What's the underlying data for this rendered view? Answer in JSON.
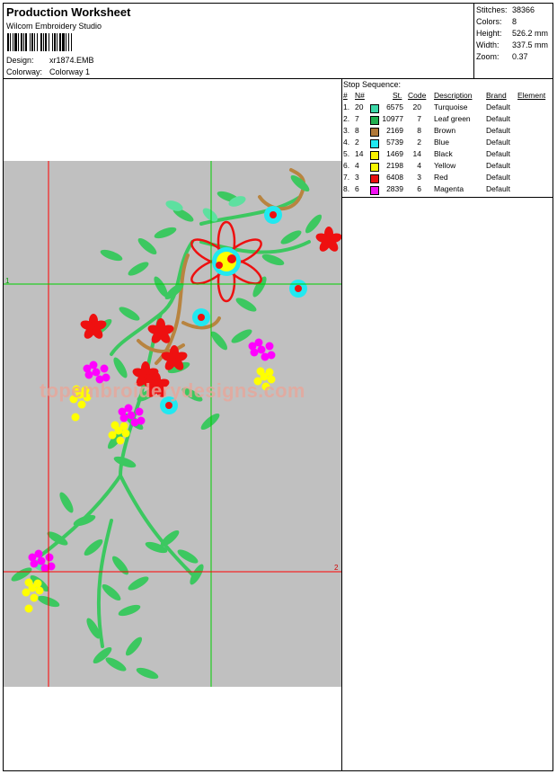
{
  "header": {
    "title": "Production Worksheet",
    "software": "Wilcom  Embroidery Studio",
    "design_label": "Design:",
    "design_value": "xr1874.EMB",
    "colorway_label": "Colorway:",
    "colorway_value": "Colorway 1"
  },
  "stats": [
    {
      "label": "Stitches:",
      "value": "38366"
    },
    {
      "label": "Colors:",
      "value": "8"
    },
    {
      "label": "Height:",
      "value": "526.2 mm"
    },
    {
      "label": "Width:",
      "value": "337.5 mm"
    },
    {
      "label": "Zoom:",
      "value": "0.37"
    }
  ],
  "stop_sequence": {
    "title": "Stop Sequence:",
    "columns": [
      "#",
      "N#",
      "St.",
      "Code",
      "Description",
      "Brand",
      "Element"
    ],
    "rows": [
      {
        "num": "1.",
        "n": "20",
        "color": "#3cd8a8",
        "st": "6575",
        "code": "20",
        "desc": "Turquoise",
        "brand": "Default"
      },
      {
        "num": "2.",
        "n": "7",
        "color": "#22b050",
        "st": "10977",
        "code": "7",
        "desc": "Leaf green",
        "brand": "Default"
      },
      {
        "num": "3.",
        "n": "8",
        "color": "#b07838",
        "st": "2169",
        "code": "8",
        "desc": "Brown",
        "brand": "Default"
      },
      {
        "num": "4.",
        "n": "2",
        "color": "#20e8f0",
        "st": "5739",
        "code": "2",
        "desc": "Blue",
        "brand": "Default"
      },
      {
        "num": "5.",
        "n": "14",
        "color": "#f8f000",
        "st": "1469",
        "code": "14",
        "desc": "Black",
        "brand": "Default"
      },
      {
        "num": "6.",
        "n": "4",
        "color": "#f8f800",
        "st": "2198",
        "code": "4",
        "desc": "Yellow",
        "brand": "Default"
      },
      {
        "num": "7.",
        "n": "3",
        "color": "#e81010",
        "st": "6408",
        "code": "3",
        "desc": "Red",
        "brand": "Default"
      },
      {
        "num": "8.",
        "n": "6",
        "color": "#f010f0",
        "st": "2839",
        "code": "6",
        "desc": "Magenta",
        "brand": "Default"
      }
    ]
  },
  "canvas": {
    "watermark": "topembroiderydesigns.com",
    "marker_1": "1",
    "marker_2": "2",
    "colors": {
      "background": "#c0c0c0",
      "leaf": "#3cc860",
      "leaf_light": "#5ee0a0",
      "brown": "#b88440",
      "red": "#ee1010",
      "cyan": "#22e8f0",
      "yellow": "#ffff00",
      "magenta": "#ff00ff",
      "guide_red": "#ff0000",
      "guide_green": "#00d000"
    }
  }
}
